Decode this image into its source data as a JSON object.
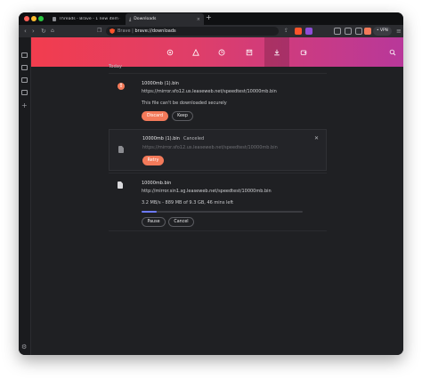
{
  "tabs": [
    {
      "title": "Threads - Brave - 1 new item - Disc",
      "active": false
    },
    {
      "title": "Downloads",
      "active": true
    }
  ],
  "omnibox": {
    "prefix": "Brave",
    "separator": " | ",
    "path": "brave://downloads"
  },
  "toolbar": {
    "vpn_label": "• VPN"
  },
  "section_title": "Today",
  "downloads": [
    {
      "filename": "10000mb (1).bin",
      "status": "",
      "url": "https://mirror.sfo12.us.leaseweb.net/speedtest/10000mb.bin",
      "message": "This file can't be downloaded securely",
      "primary_button": "Discard",
      "secondary_button": "Keep"
    },
    {
      "filename": "10000mb (1).bin",
      "status": "Canceled",
      "url": "https://mirror.sfo12.us.leaseweb.net/speedtest/10000mb.bin",
      "primary_button": "Retry"
    },
    {
      "filename": "10000mb.bin",
      "status": "",
      "url": "http://mirror.sin1.sg.leaseweb.net/speedtest/10000mb.bin",
      "message": "3.2 MB/s - 889 MB of 9.3 GB, 46 mins left",
      "progress_fraction": 0.093,
      "primary_button": "Pause",
      "secondary_button": "Cancel"
    }
  ],
  "colors": {
    "accent": "#f37a5a",
    "header_start": "#f23d4e",
    "header_end": "#b8389a",
    "progress": "#6d7bff",
    "background": "#1f2023"
  }
}
